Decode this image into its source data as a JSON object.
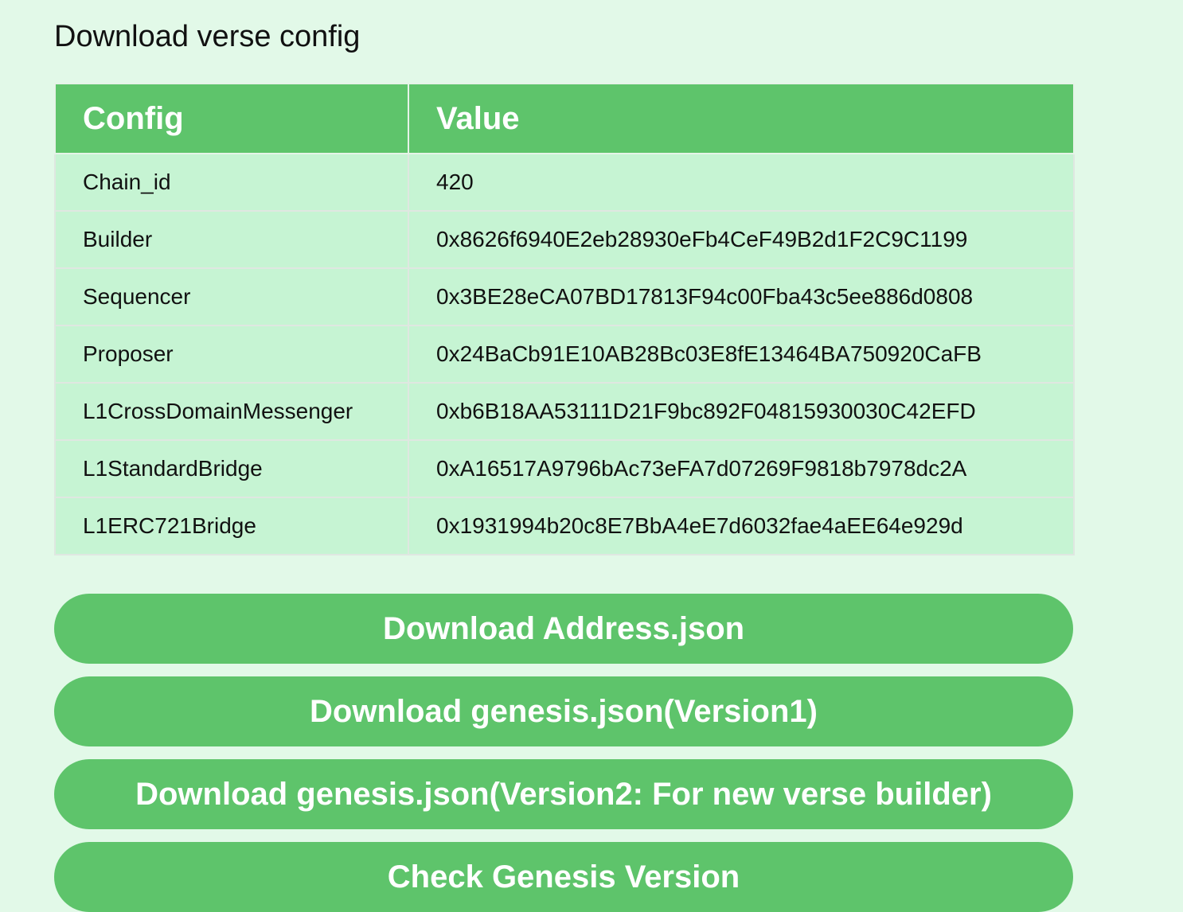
{
  "page": {
    "title": "Download verse config"
  },
  "table": {
    "headers": {
      "config": "Config",
      "value": "Value"
    },
    "rows": [
      {
        "key": "Chain_id",
        "value": "420"
      },
      {
        "key": "Builder",
        "value": "0x8626f6940E2eb28930eFb4CeF49B2d1F2C9C1199"
      },
      {
        "key": "Sequencer",
        "value": "0x3BE28eCA07BD17813F94c00Fba43c5ee886d0808"
      },
      {
        "key": "Proposer",
        "value": "0x24BaCb91E10AB28Bc03E8fE13464BA750920CaFB"
      },
      {
        "key": "L1CrossDomainMessenger",
        "value": "0xb6B18AA53111D21F9bc892F04815930030C42EFD"
      },
      {
        "key": "L1StandardBridge",
        "value": "0xA16517A9796bAc73eFA7d07269F9818b7978dc2A"
      },
      {
        "key": "L1ERC721Bridge",
        "value": "0x1931994b20c8E7BbA4eE7d6032fae4aEE64e929d"
      }
    ]
  },
  "buttons": {
    "download_address": "Download Address.json",
    "download_genesis_v1": "Download genesis.json(Version1)",
    "download_genesis_v2": "Download genesis.json(Version2: For new verse builder)",
    "check_genesis_version": "Check Genesis Version"
  },
  "colors": {
    "background": "#e2f9e8",
    "accent_green": "#5ec46b",
    "row_green": "#c6f4d3"
  }
}
